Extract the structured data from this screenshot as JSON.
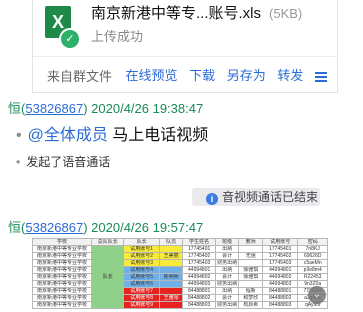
{
  "file_message": {
    "file_name": "南京新港中等专...账号.xls",
    "file_size": "(5KB)",
    "upload_status": "上传成功",
    "source": "来自群文件",
    "actions": [
      "在线预览",
      "下载",
      "另存为",
      "转发"
    ],
    "file_icon": "excel-icon",
    "file_icon_letter": "X"
  },
  "messages": [
    {
      "sender": "恒",
      "uid": "53826867",
      "timestamp": "2020/4/26 19:38:47",
      "mention": "@全体成员",
      "text": " 马上电话视频",
      "line2": "发起了语音通话",
      "system_notice": "音视频通话已结束"
    },
    {
      "sender": "恒",
      "uid": "53826867",
      "timestamp": "2020/4/26 19:57:47"
    }
  ],
  "sheet": {
    "headers": [
      "学校",
      "总队队长",
      "队长",
      "队员",
      "学生姓名",
      "班级",
      "教师",
      "试用账号",
      "密码"
    ],
    "school": "南京新港中等专业学校",
    "captain": "队长",
    "rows": [
      [
        "试用账号1",
        "",
        "17745401",
        "出纳",
        "",
        "17745401",
        "7n8KJ"
      ],
      [
        "试用账号2",
        "王美丽",
        "17745402",
        "会计",
        "无阻",
        "17745402",
        "69626D"
      ],
      [
        "试用账号3",
        "",
        "17745403",
        "财务出纳",
        "",
        "17745403",
        "c5aeMn"
      ],
      [
        "试用账号4",
        "",
        "44994801",
        "出纳",
        "徐雅琪",
        "44994801",
        "p3e8m4"
      ],
      [
        "试用账号5",
        "陈明师",
        "44994802",
        "会计",
        "徐雅琪",
        "44994802",
        "R22453"
      ],
      [
        "试用账号6",
        "",
        "44994803",
        "财务出纳",
        "",
        "44994803",
        "9n3Z0a"
      ],
      [
        "试用账号7",
        "",
        "84488801",
        "出纳",
        "程新",
        "84488801",
        "7TH9A4"
      ],
      [
        "试用账号8",
        "王雅琴",
        "84488802",
        "会计",
        "和梦欣",
        "84488802",
        "a3g4Hy"
      ],
      [
        "试用账号9",
        "",
        "84488803",
        "财务出纳",
        "有辰希",
        "84488803",
        "qAy9f9"
      ]
    ]
  },
  "colors": {
    "link": "#2b6bd6",
    "header_green": "#1a8a5a",
    "excel_green": "#1e8a4a",
    "cell_green": "#8fd08a",
    "cell_yellow": "#f7ea3a",
    "cell_blue": "#6fb0e8",
    "cell_red": "#e8231f"
  }
}
